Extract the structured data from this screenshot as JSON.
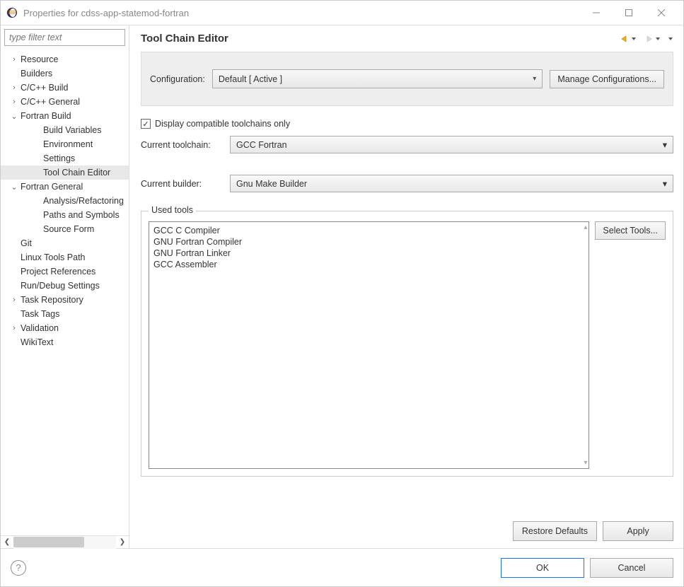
{
  "window": {
    "title": "Properties for cdss-app-statemod-fortran"
  },
  "sidebar": {
    "filter_placeholder": "type filter text",
    "items": [
      {
        "label": "Resource",
        "level": 1,
        "arrow": ">"
      },
      {
        "label": "Builders",
        "level": 1,
        "arrow": ""
      },
      {
        "label": "C/C++ Build",
        "level": 1,
        "arrow": ">"
      },
      {
        "label": "C/C++ General",
        "level": 1,
        "arrow": ">"
      },
      {
        "label": "Fortran Build",
        "level": 1,
        "arrow": "v"
      },
      {
        "label": "Build Variables",
        "level": 2,
        "arrow": ""
      },
      {
        "label": "Environment",
        "level": 2,
        "arrow": ""
      },
      {
        "label": "Settings",
        "level": 2,
        "arrow": ""
      },
      {
        "label": "Tool Chain Editor",
        "level": 2,
        "arrow": "",
        "selected": true
      },
      {
        "label": "Fortran General",
        "level": 1,
        "arrow": "v"
      },
      {
        "label": "Analysis/Refactoring",
        "level": 2,
        "arrow": ""
      },
      {
        "label": "Paths and Symbols",
        "level": 2,
        "arrow": ""
      },
      {
        "label": "Source Form",
        "level": 2,
        "arrow": ""
      },
      {
        "label": "Git",
        "level": 1,
        "arrow": ""
      },
      {
        "label": "Linux Tools Path",
        "level": 1,
        "arrow": ""
      },
      {
        "label": "Project References",
        "level": 1,
        "arrow": ""
      },
      {
        "label": "Run/Debug Settings",
        "level": 1,
        "arrow": ""
      },
      {
        "label": "Task Repository",
        "level": 1,
        "arrow": ">"
      },
      {
        "label": "Task Tags",
        "level": 1,
        "arrow": ""
      },
      {
        "label": "Validation",
        "level": 1,
        "arrow": ">"
      },
      {
        "label": "WikiText",
        "level": 1,
        "arrow": ""
      }
    ]
  },
  "page": {
    "title": "Tool Chain Editor",
    "config_label": "Configuration:",
    "config_value": "Default  [ Active ]",
    "manage_btn": "Manage Configurations...",
    "compat_checkbox": "Display compatible toolchains only",
    "compat_checked": true,
    "toolchain_label": "Current toolchain:",
    "toolchain_value": "GCC Fortran",
    "builder_label": "Current builder:",
    "builder_value": "Gnu Make Builder",
    "used_tools_label": "Used tools",
    "used_tools": [
      "GCC C Compiler",
      "GNU Fortran Compiler",
      "GNU Fortran Linker",
      "GCC Assembler"
    ],
    "select_tools_btn": "Select Tools...",
    "restore_btn": "Restore Defaults",
    "apply_btn": "Apply"
  },
  "footer": {
    "ok": "OK",
    "cancel": "Cancel"
  }
}
